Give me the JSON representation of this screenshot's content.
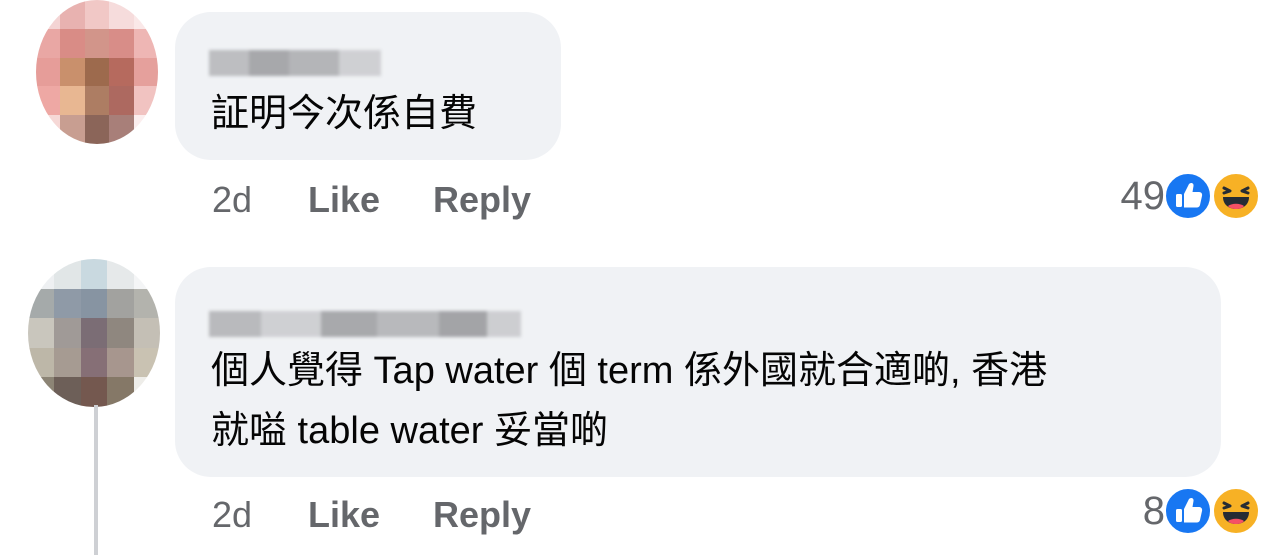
{
  "comments": [
    {
      "text": "証明今次係自費",
      "time": "2d",
      "like_label": "Like",
      "reply_label": "Reply",
      "reaction_count": "49",
      "reactions": [
        "like-icon",
        "haha-icon"
      ]
    },
    {
      "text": "個人覺得 Tap water 個 term 係外國就合適啲, 香港\n就嗌 table water 妥當啲",
      "time": "2d",
      "like_label": "Like",
      "reply_label": "Reply",
      "reaction_count": "8",
      "reactions": [
        "like-icon",
        "haha-icon"
      ]
    }
  ],
  "colors": {
    "bubble": "#f0f2f5",
    "meta_text": "#65676b",
    "like_blue": "#1877f2",
    "haha_yellow": "#f7b125"
  }
}
